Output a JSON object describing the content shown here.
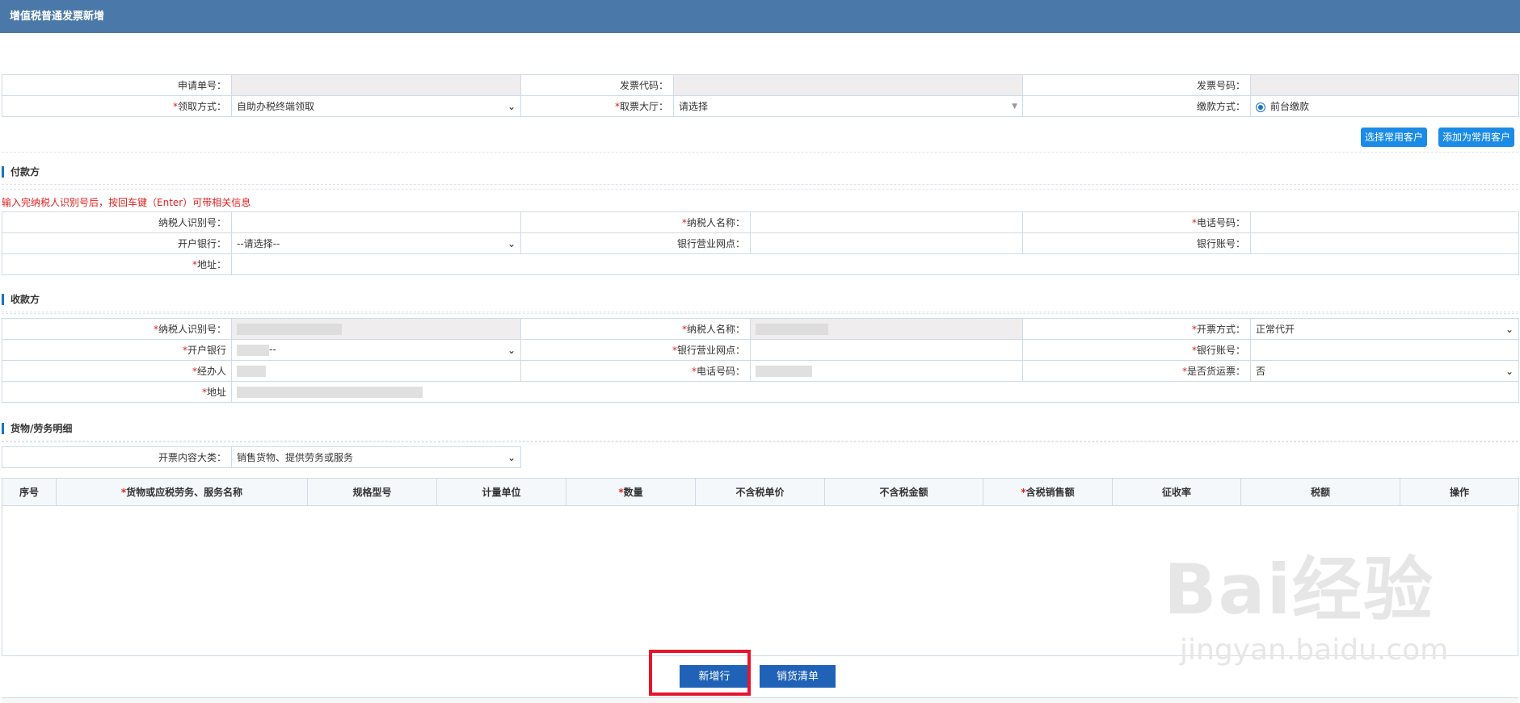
{
  "window": {
    "title": "增值税普通发票新增"
  },
  "header_form": {
    "application_no_label": "申请单号：",
    "invoice_code_label": "发票代码：",
    "invoice_no_label": "发票号码：",
    "pickup_method_label": "领取方式：",
    "pickup_method_value": "自助办税终端领取",
    "pickup_hall_label": "取票大厅：",
    "pickup_hall_placeholder": "请选择",
    "payment_method_label": "缴款方式：",
    "payment_method_value": "前台缴款"
  },
  "customer_buttons": {
    "select": "选择常用客户",
    "add": "添加为常用客户"
  },
  "payer": {
    "section_title": "付款方",
    "hint": "输入完纳税人识别号后，按回车键（Enter）可带相关信息",
    "taxpayer_id_label": "纳税人识别号：",
    "taxpayer_name_label": "纳税人名称：",
    "phone_label": "电话号码：",
    "bank_label": "开户银行：",
    "bank_value": "--请选择--",
    "branch_label": "银行营业网点：",
    "account_label": "银行账号：",
    "address_label": "地址："
  },
  "payee": {
    "section_title": "收款方",
    "taxpayer_id_label": "纳税人识别号：",
    "taxpayer_name_label": "纳税人名称：",
    "invoice_mode_label": "开票方式：",
    "invoice_mode_value": "正常代开",
    "bank_label": "开户银行",
    "bank_value": "--",
    "branch_label": "银行营业网点：",
    "account_label": "银行账号：",
    "agent_label": "经办人",
    "phone_label": "电话号码：",
    "freight_label": "是否货运票：",
    "freight_value": "否",
    "address_label": "地址"
  },
  "goods": {
    "section_title": "货物/劳务明细",
    "category_label": "开票内容大类：",
    "category_value": "销售货物、提供劳务或服务",
    "columns": [
      "序号",
      "货物或应税劳务、服务名称",
      "规格型号",
      "计量单位",
      "数量",
      "不含税单价",
      "不含税金额",
      "含税销售额",
      "征收率",
      "税额",
      "操作"
    ]
  },
  "actions": {
    "add_row": "新增行",
    "sales_list": "销货清单"
  },
  "watermark": {
    "main": "Bai经验",
    "sub": "jingyan.baidu.com"
  },
  "colors": {
    "title_bar": "#4a79a9",
    "required": "#e02020",
    "button": "#1a8be6",
    "highlight": "#e8142d"
  }
}
